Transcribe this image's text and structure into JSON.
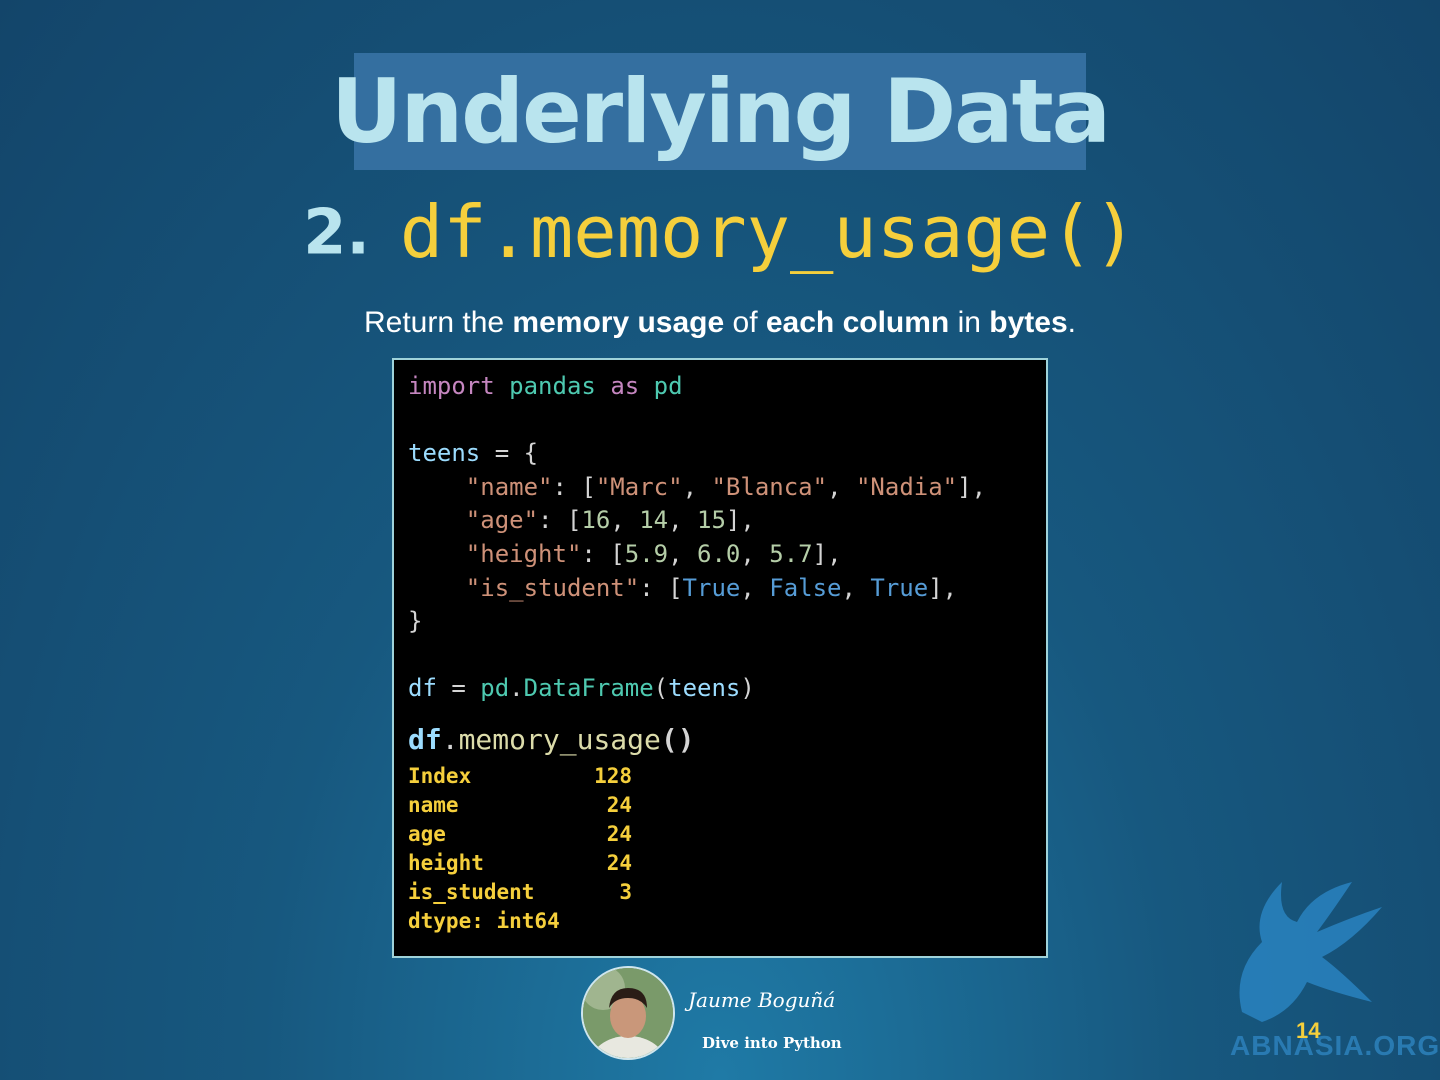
{
  "title": "Underlying Data",
  "subtitle": {
    "number": "2.",
    "code_prefix": "df.",
    "code_method": "memory_usage()"
  },
  "description": {
    "p1": "Return the ",
    "b1": "memory usage",
    "p2": " of ",
    "b2": "each column",
    "p3": " in ",
    "b3": "bytes",
    "p4": "."
  },
  "code": {
    "l1_import": "import",
    "l1_module": "pandas",
    "l1_as": "as",
    "l1_alias": "pd",
    "l2_var": "teens",
    "l2_rest": " = {",
    "k_name": "\"name\"",
    "v_name": [
      "\"Marc\"",
      "\"Blanca\"",
      "\"Nadia\""
    ],
    "k_age": "\"age\"",
    "v_age": [
      "16",
      "14",
      "15"
    ],
    "k_height": "\"height\"",
    "v_height": [
      "5.9",
      "6.0",
      "5.7"
    ],
    "k_student": "\"is_student\"",
    "v_student": [
      "True",
      "False",
      "True"
    ],
    "close": "}",
    "df_var": "df",
    "df_mod": "pd",
    "df_cls": "DataFrame",
    "df_arg": "teens",
    "call_var": "df",
    "call_fn": "memory_usage"
  },
  "output": {
    "rows": [
      {
        "label": "Index",
        "value": "128"
      },
      {
        "label": "name",
        "value": "24"
      },
      {
        "label": "age",
        "value": "24"
      },
      {
        "label": "height",
        "value": "24"
      },
      {
        "label": "is_student",
        "value": "3"
      }
    ],
    "dtype": "dtype: int64"
  },
  "footer": {
    "author": "Jaume Boguñá",
    "course": "Dive into Python",
    "page": "14",
    "watermark": "ABNASIA.ORG"
  },
  "colors": {
    "background": "#17587f",
    "title_box": "#346fa0",
    "title_text": "#b9e4ee",
    "accent_yellow": "#f5cf3c",
    "code_bg": "#000000",
    "code_border": "#9fd3da"
  }
}
